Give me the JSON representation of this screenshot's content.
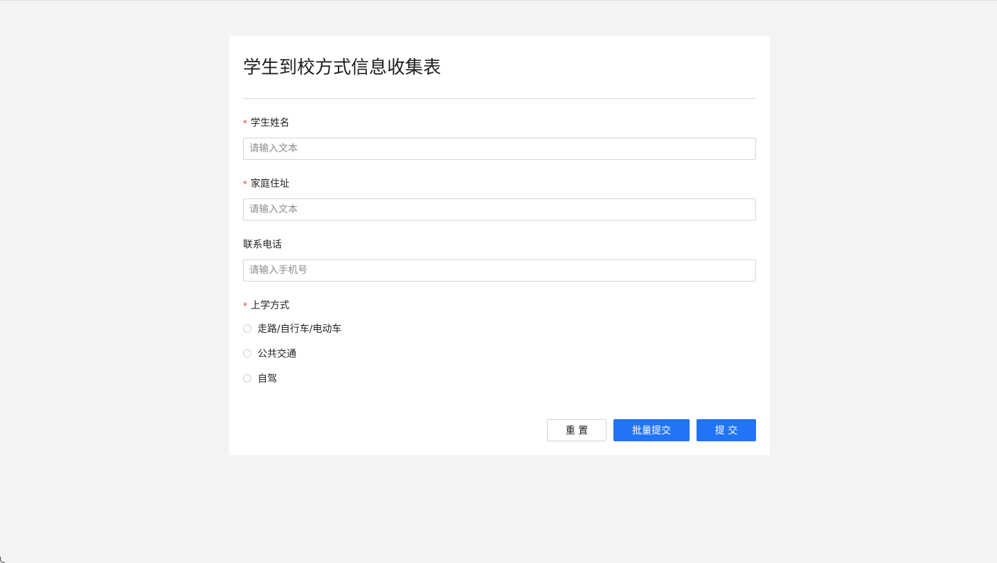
{
  "form": {
    "title": "学生到校方式信息收集表",
    "fields": [
      {
        "label": "学生姓名",
        "required": true,
        "required_mark": "*",
        "placeholder": "请输入文本",
        "value": ""
      },
      {
        "label": "家庭住址",
        "required": true,
        "required_mark": "*",
        "placeholder": "请输入文本",
        "value": ""
      },
      {
        "label": "联系电话",
        "required": false,
        "placeholder": "请输入手机号",
        "value": ""
      }
    ],
    "commute": {
      "label": "上学方式",
      "required": true,
      "required_mark": "*",
      "options": [
        "走路/自行车/电动车",
        "公共交通",
        "自驾"
      ],
      "selected": null
    }
  },
  "actions": {
    "reset_label": "重 置",
    "batch_submit_label": "批量提交",
    "submit_label": "提 交"
  },
  "colors": {
    "page_background": "#f3f3f3",
    "card_background": "#ffffff",
    "primary": "#2174f5",
    "required": "#e53935",
    "placeholder": "#8c8c8c",
    "border": "#d4d4d4"
  }
}
